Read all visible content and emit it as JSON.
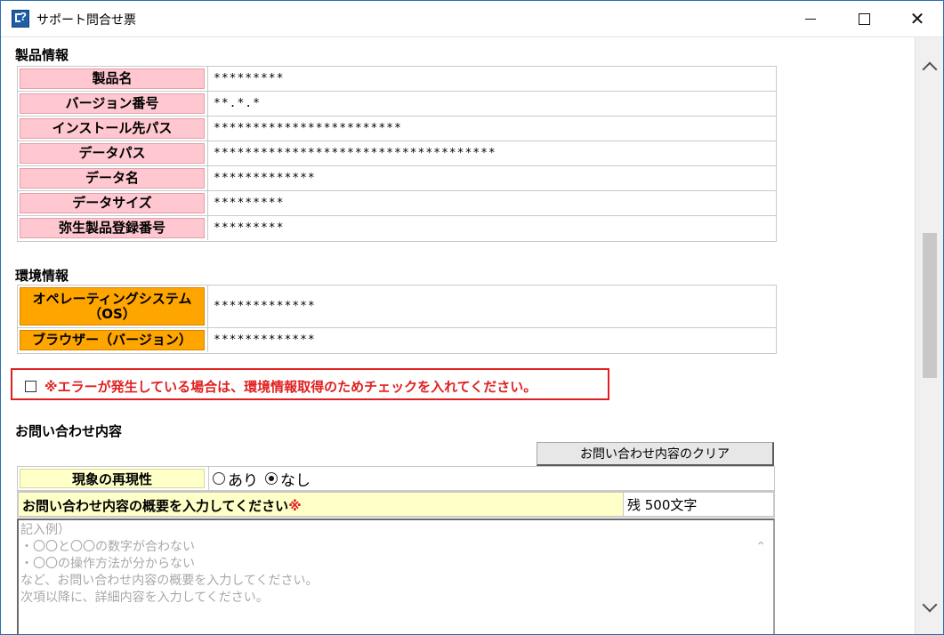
{
  "window": {
    "title": "サポート問合せ票"
  },
  "product": {
    "section_title": "製品情報",
    "rows": [
      {
        "label": "製品名",
        "value": "*********"
      },
      {
        "label": "バージョン番号",
        "value": "**.*.*"
      },
      {
        "label": "インストール先パス",
        "value": "************************"
      },
      {
        "label": "データパス",
        "value": "************************************"
      },
      {
        "label": "データ名",
        "value": "*************"
      },
      {
        "label": "データサイズ",
        "value": "*********"
      },
      {
        "label": "弥生製品登録番号",
        "value": "*********"
      }
    ]
  },
  "environment": {
    "section_title": "環境情報",
    "os_label_line1": "オペレーティングシステム",
    "os_label_line2": "（OS）",
    "os_value": "*************",
    "browser_label": "ブラウザー（バージョン）",
    "browser_value": "*************"
  },
  "error_check": {
    "label": "※エラーが発生している場合は、環境情報取得のためチェックを入れてください。",
    "checked": false
  },
  "inquiry": {
    "section_title": "お問い合わせ内容",
    "clear_button": "お問い合わせ内容のクリア",
    "reproducibility_label": "現象の再現性",
    "options": [
      {
        "label": "あり",
        "selected": false
      },
      {
        "label": "なし",
        "selected": true
      }
    ],
    "summary_label": "お問い合わせ内容の概要を入力してください",
    "required_mark": "※",
    "remaining": "残  500文字",
    "placeholder": "記入例）\n・〇〇と〇〇の数字が合わない\n・〇〇の操作方法が分からない\nなど、お問い合わせ内容の概要を入力してください。\n次項以降に、詳細内容を入力してください。"
  },
  "colors": {
    "pink_label": "#ffc7d0",
    "orange_label": "#ffa500",
    "yellow_label": "#ffffc8",
    "warning_red": "#e02020"
  }
}
